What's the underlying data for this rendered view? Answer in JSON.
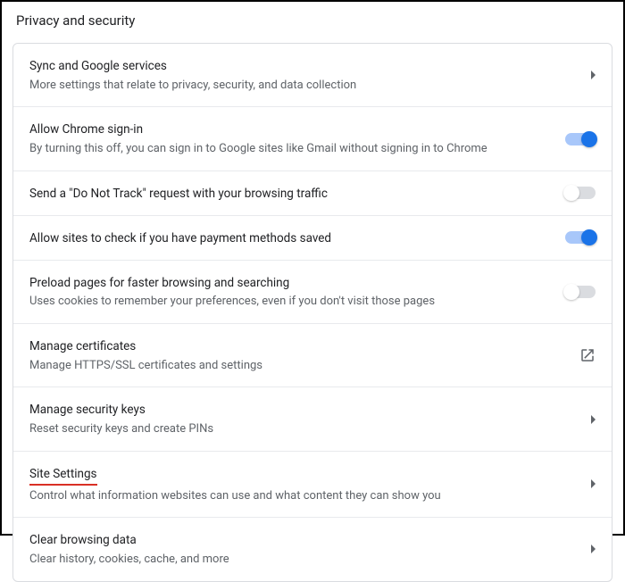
{
  "header": {
    "title": "Privacy and security"
  },
  "rows": {
    "sync": {
      "title": "Sync and Google services",
      "sub": "More settings that relate to privacy, security, and data collection"
    },
    "signin": {
      "title": "Allow Chrome sign-in",
      "sub": "By turning this off, you can sign in to Google sites like Gmail without signing in to Chrome"
    },
    "dnt": {
      "title": "Send a \"Do Not Track\" request with your browsing traffic"
    },
    "payment": {
      "title": "Allow sites to check if you have payment methods saved"
    },
    "preload": {
      "title": "Preload pages for faster browsing and searching",
      "sub": "Uses cookies to remember your preferences, even if you don't visit those pages"
    },
    "certs": {
      "title": "Manage certificates",
      "sub": "Manage HTTPS/SSL certificates and settings"
    },
    "keys": {
      "title": "Manage security keys",
      "sub": "Reset security keys and create PINs"
    },
    "site": {
      "title": "Site Settings",
      "sub": "Control what information websites can use and what content they can show you"
    },
    "clear": {
      "title": "Clear browsing data",
      "sub": "Clear history, cookies, cache, and more"
    }
  },
  "toggles": {
    "signin": true,
    "dnt": false,
    "payment": true,
    "preload": false
  }
}
